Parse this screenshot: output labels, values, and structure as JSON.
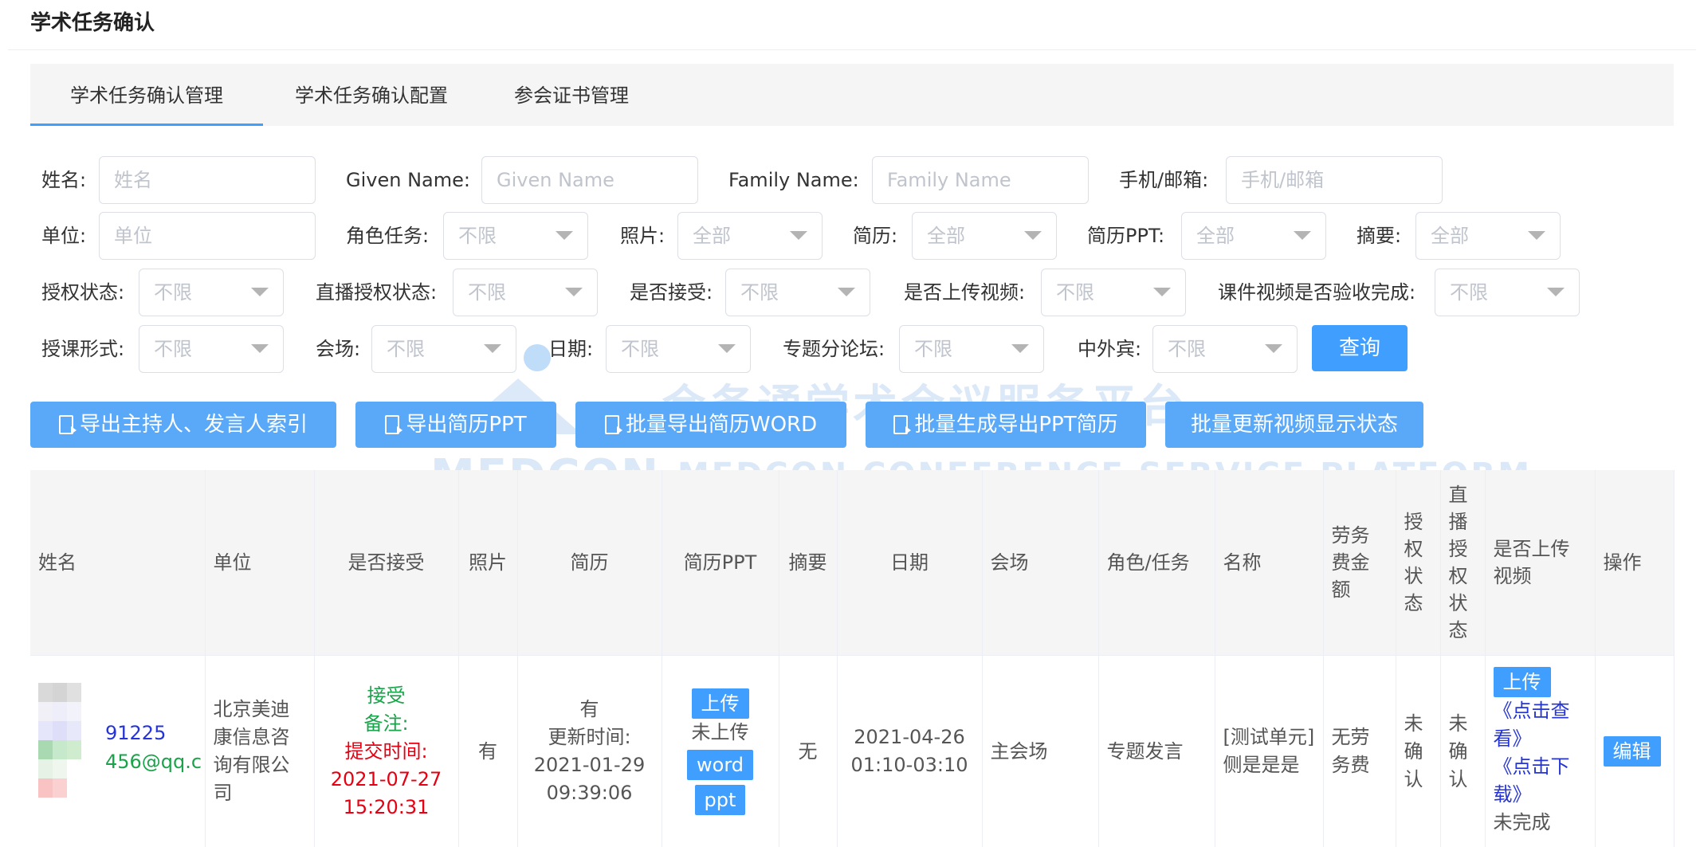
{
  "page": {
    "title": "学术任务确认"
  },
  "tabs": [
    {
      "label": "学术任务确认管理",
      "active": true
    },
    {
      "label": "学术任务确认配置",
      "active": false
    },
    {
      "label": "参会证书管理",
      "active": false
    }
  ],
  "filters": {
    "name": {
      "label": "姓名:",
      "placeholder": "姓名"
    },
    "given_name": {
      "label": "Given Name:",
      "placeholder": "Given Name"
    },
    "family_name": {
      "label": "Family Name:",
      "placeholder": "Family Name"
    },
    "contact": {
      "label": "手机/邮箱:",
      "placeholder": "手机/邮箱"
    },
    "unit": {
      "label": "单位:",
      "placeholder": "单位"
    },
    "role_task": {
      "label": "角色任务:",
      "value": "不限"
    },
    "photo": {
      "label": "照片:",
      "value": "全部"
    },
    "resume": {
      "label": "简历:",
      "value": "全部"
    },
    "resume_ppt": {
      "label": "简历PPT:",
      "value": "全部"
    },
    "abstract": {
      "label": "摘要:",
      "value": "全部"
    },
    "auth_status": {
      "label": "授权状态:",
      "value": "不限"
    },
    "live_auth_status": {
      "label": "直播授权状态:",
      "value": "不限"
    },
    "accepted": {
      "label": "是否接受:",
      "value": "不限"
    },
    "video_uploaded": {
      "label": "是否上传视频:",
      "value": "不限"
    },
    "video_checked": {
      "label": "课件视频是否验收完成:",
      "value": "不限"
    },
    "lecture_form": {
      "label": "授课形式:",
      "value": "不限"
    },
    "venue": {
      "label": "会场:",
      "value": "不限"
    },
    "date": {
      "label": "日期:",
      "value": "不限"
    },
    "forum": {
      "label": "专题分论坛:",
      "value": "不限"
    },
    "guest_type": {
      "label": "中外宾:",
      "value": "不限"
    },
    "query_label": "查询"
  },
  "actions": [
    {
      "label": "导出主持人、发言人索引",
      "icon": "document-export-icon"
    },
    {
      "label": "导出简历PPT",
      "icon": "document-export-icon"
    },
    {
      "label": "批量导出简历WORD",
      "icon": "document-export-icon"
    },
    {
      "label": "批量生成导出PPT简历",
      "icon": "document-export-icon"
    },
    {
      "label": "批量更新视频显示状态",
      "icon": ""
    }
  ],
  "watermark": {
    "cn": "会务通学术会议服务平台",
    "logo": "MEDCON",
    "en": "MEDCON CONFERENCE SERVICE PLATFORM"
  },
  "table": {
    "headers": [
      "姓名",
      "单位",
      "是否接受",
      "照片",
      "简历",
      "简历PPT",
      "摘要",
      "日期",
      "会场",
      "角色/任务",
      "名称",
      "劳务费金额",
      "授权状态",
      "直播授权状态",
      "是否上传视频",
      "操作"
    ],
    "rows": [
      {
        "phone_tail": "91225",
        "email_tail": "456@qq.c",
        "unit": "北京美迪康信息咨询有限公司",
        "accept": "接受",
        "remark": "备注:",
        "submit_label": "提交时间:",
        "submit_time": "2021-07-27 15:20:31",
        "photo": "有",
        "resume": "有",
        "resume_update_label": "更新时间:",
        "resume_update_time": "2021-01-29 09:39:06",
        "ppt_upload": "上传",
        "ppt_status": "未上传",
        "ppt_word": "word",
        "ppt_ppt": "ppt",
        "abstract": "无",
        "date": "2021-04-26 01:10-03:10",
        "venue": "主会场",
        "role": "专题发言",
        "title": "[测试单元]侧是是是",
        "fee": "无劳务费",
        "auth": "未确认",
        "live_auth": "未确认",
        "video_upload": "上传",
        "video_view": "《点击查看》",
        "video_download": "《点击下载》",
        "video_status": "未完成",
        "edit": "编辑"
      }
    ]
  },
  "colors": {
    "accent": "#409eff",
    "green": "#1aa34a",
    "red": "#e60012",
    "link": "#2434d8"
  }
}
